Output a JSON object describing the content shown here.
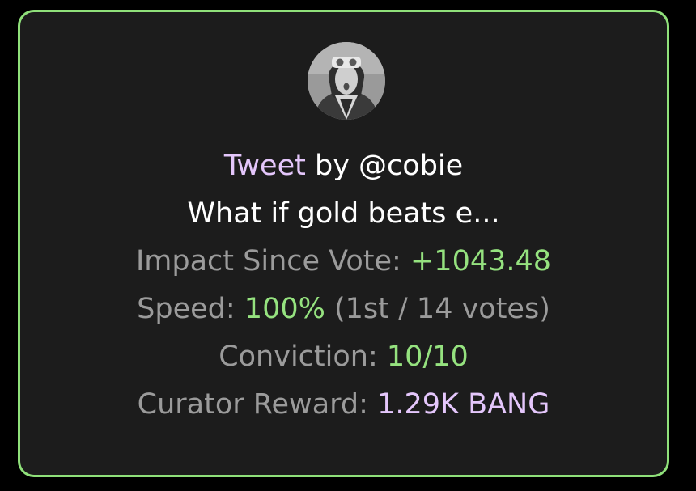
{
  "card": {
    "colors": {
      "border": "#8fe07a",
      "background": "#1c1c1c",
      "label": "#9b9b9b",
      "green": "#95e27f",
      "purple": "#e4c6fb"
    },
    "avatar_icon": "user-avatar",
    "tweet_word": "Tweet",
    "by_text": "by @cobie",
    "tweet_excerpt": "What if gold beats e...",
    "impact": {
      "label": "Impact Since Vote:",
      "value": "+1043.48"
    },
    "speed": {
      "label": "Speed:",
      "value": "100%",
      "detail": "(1st / 14 votes)"
    },
    "conviction": {
      "label": "Conviction:",
      "value": "10/10"
    },
    "curator_reward": {
      "label": "Curator Reward:",
      "value": "1.29K BANG"
    }
  }
}
